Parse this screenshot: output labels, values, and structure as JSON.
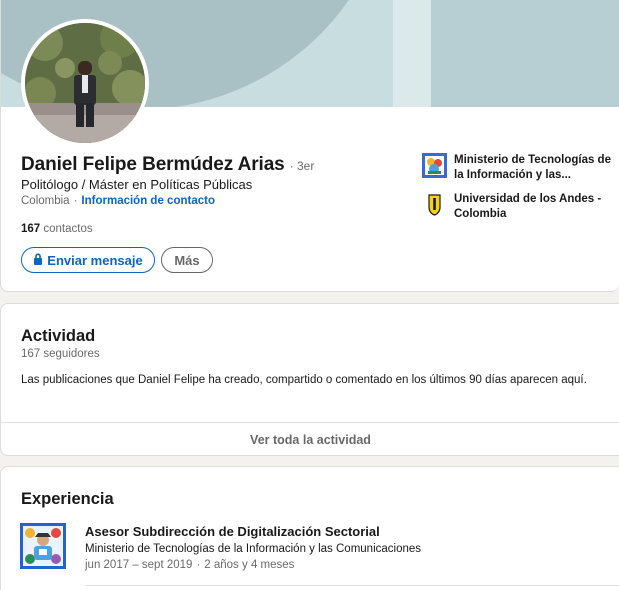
{
  "profile": {
    "name": "Daniel Felipe Bermúdez Arias",
    "degree": "· 3er",
    "headline": "Politólogo / Máster en Políticas Públicas",
    "location": "Colombia",
    "separator": "·",
    "contact_link": "Información de contacto",
    "connections_count": "167",
    "connections_label": "contactos",
    "message_button": "Enviar mensaje",
    "more_button": "Más",
    "icons": {
      "avatar": "profile-photo",
      "lock": "lock-icon"
    }
  },
  "organizations": [
    {
      "name": "Ministerio de Tecnologías de la Información y las...",
      "logo": "mintic-logo"
    },
    {
      "name": "Universidad de los Andes - Colombia",
      "logo": "uniandes-logo"
    }
  ],
  "activity": {
    "title": "Actividad",
    "followers": "167 seguidores",
    "description": "Las publicaciones que Daniel Felipe ha creado, compartido o comentado en los últimos 90 días aparecen aquí.",
    "see_all": "Ver toda la actividad"
  },
  "experience": {
    "title": "Experiencia",
    "items": [
      {
        "role": "Asesor Subdirección de Digitalización Sectorial",
        "company": "Ministerio de Tecnologías de la Información y las Comunicaciones",
        "date_range": "jun 2017 – sept 2019",
        "duration": "2 años y 4 meses",
        "logo": "mintic-logo"
      }
    ]
  },
  "colors": {
    "brand_blue": "#0a66c2",
    "page_bg": "#f3f2ef",
    "cover": "#c8dde0"
  }
}
